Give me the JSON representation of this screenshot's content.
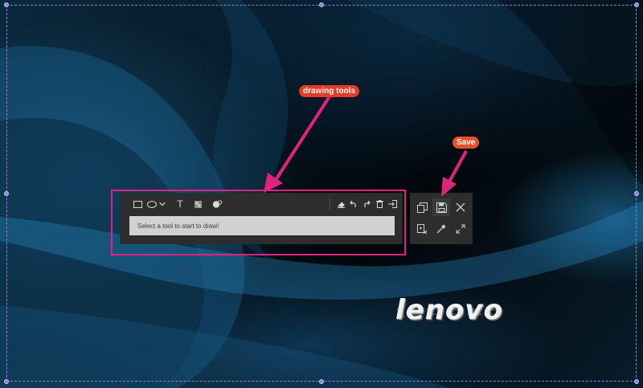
{
  "wallpaper": {
    "brand": "lenovo"
  },
  "toolbar": {
    "tools": [
      {
        "name": "rectangle",
        "icon": "rectangle-icon"
      },
      {
        "name": "ellipse",
        "icon": "ellipse-icon"
      },
      {
        "name": "shape-dropdown",
        "icon": "chevron-down-icon"
      },
      {
        "name": "text",
        "icon": "text-icon",
        "glyph": "T"
      },
      {
        "name": "mosaic",
        "icon": "mosaic-icon"
      },
      {
        "name": "marker",
        "icon": "marker-icon"
      }
    ],
    "actions": [
      {
        "name": "eraser",
        "icon": "eraser-icon"
      },
      {
        "name": "undo",
        "icon": "undo-icon"
      },
      {
        "name": "redo",
        "icon": "redo-icon"
      },
      {
        "name": "delete",
        "icon": "trash-icon"
      },
      {
        "name": "exit",
        "icon": "exit-icon"
      }
    ],
    "hint": "Select a tool to start to draw!"
  },
  "side_panel": {
    "buttons": [
      {
        "name": "copy",
        "icon": "copy-icon"
      },
      {
        "name": "save",
        "icon": "save-icon"
      },
      {
        "name": "close",
        "icon": "close-icon"
      },
      {
        "name": "pin",
        "icon": "pin-to-screen-icon"
      },
      {
        "name": "color-picker",
        "icon": "color-picker-icon"
      },
      {
        "name": "fullscreen",
        "icon": "expand-icon"
      }
    ]
  },
  "annotations": {
    "drawing_tools": "drawing tools",
    "save": "Save"
  },
  "colors": {
    "highlight": "#e0237c",
    "arrow": "#e0237c",
    "selection_handle": "#8b84dd",
    "toolbar_bg": "#2d2d2d"
  }
}
